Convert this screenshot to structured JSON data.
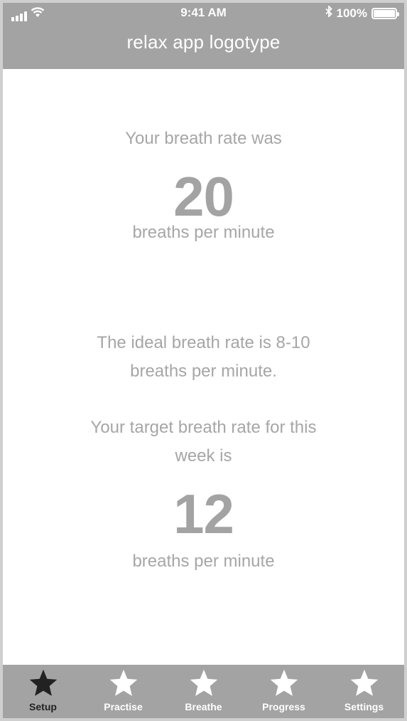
{
  "status_bar": {
    "time": "9:41 AM",
    "battery": "100%",
    "icons": [
      "signal-icon",
      "wifi-icon",
      "bluetooth-icon",
      "battery-icon"
    ]
  },
  "header": {
    "title": "relax app logotype"
  },
  "result": {
    "intro": "Your breath rate was",
    "value": "20",
    "unit": "breaths per minute"
  },
  "info": {
    "ideal_line1": "The ideal breath rate is 8-10",
    "ideal_line2": "breaths per minute.",
    "target_line1": "Your target breath rate for this",
    "target_line2": "week is"
  },
  "target": {
    "value": "12",
    "unit": "breaths per minute"
  },
  "tabs": [
    {
      "label": "Setup",
      "icon": "star-icon",
      "active": true
    },
    {
      "label": "Practise",
      "icon": "star-icon",
      "active": false
    },
    {
      "label": "Breathe",
      "icon": "star-icon",
      "active": false
    },
    {
      "label": "Progress",
      "icon": "star-icon",
      "active": false
    },
    {
      "label": "Settings",
      "icon": "star-icon",
      "active": false
    }
  ],
  "colors": {
    "bar": "#a3a3a3",
    "text_muted": "#a6a6a6",
    "active_tab": "#222222",
    "inactive_tab": "#ffffff"
  }
}
